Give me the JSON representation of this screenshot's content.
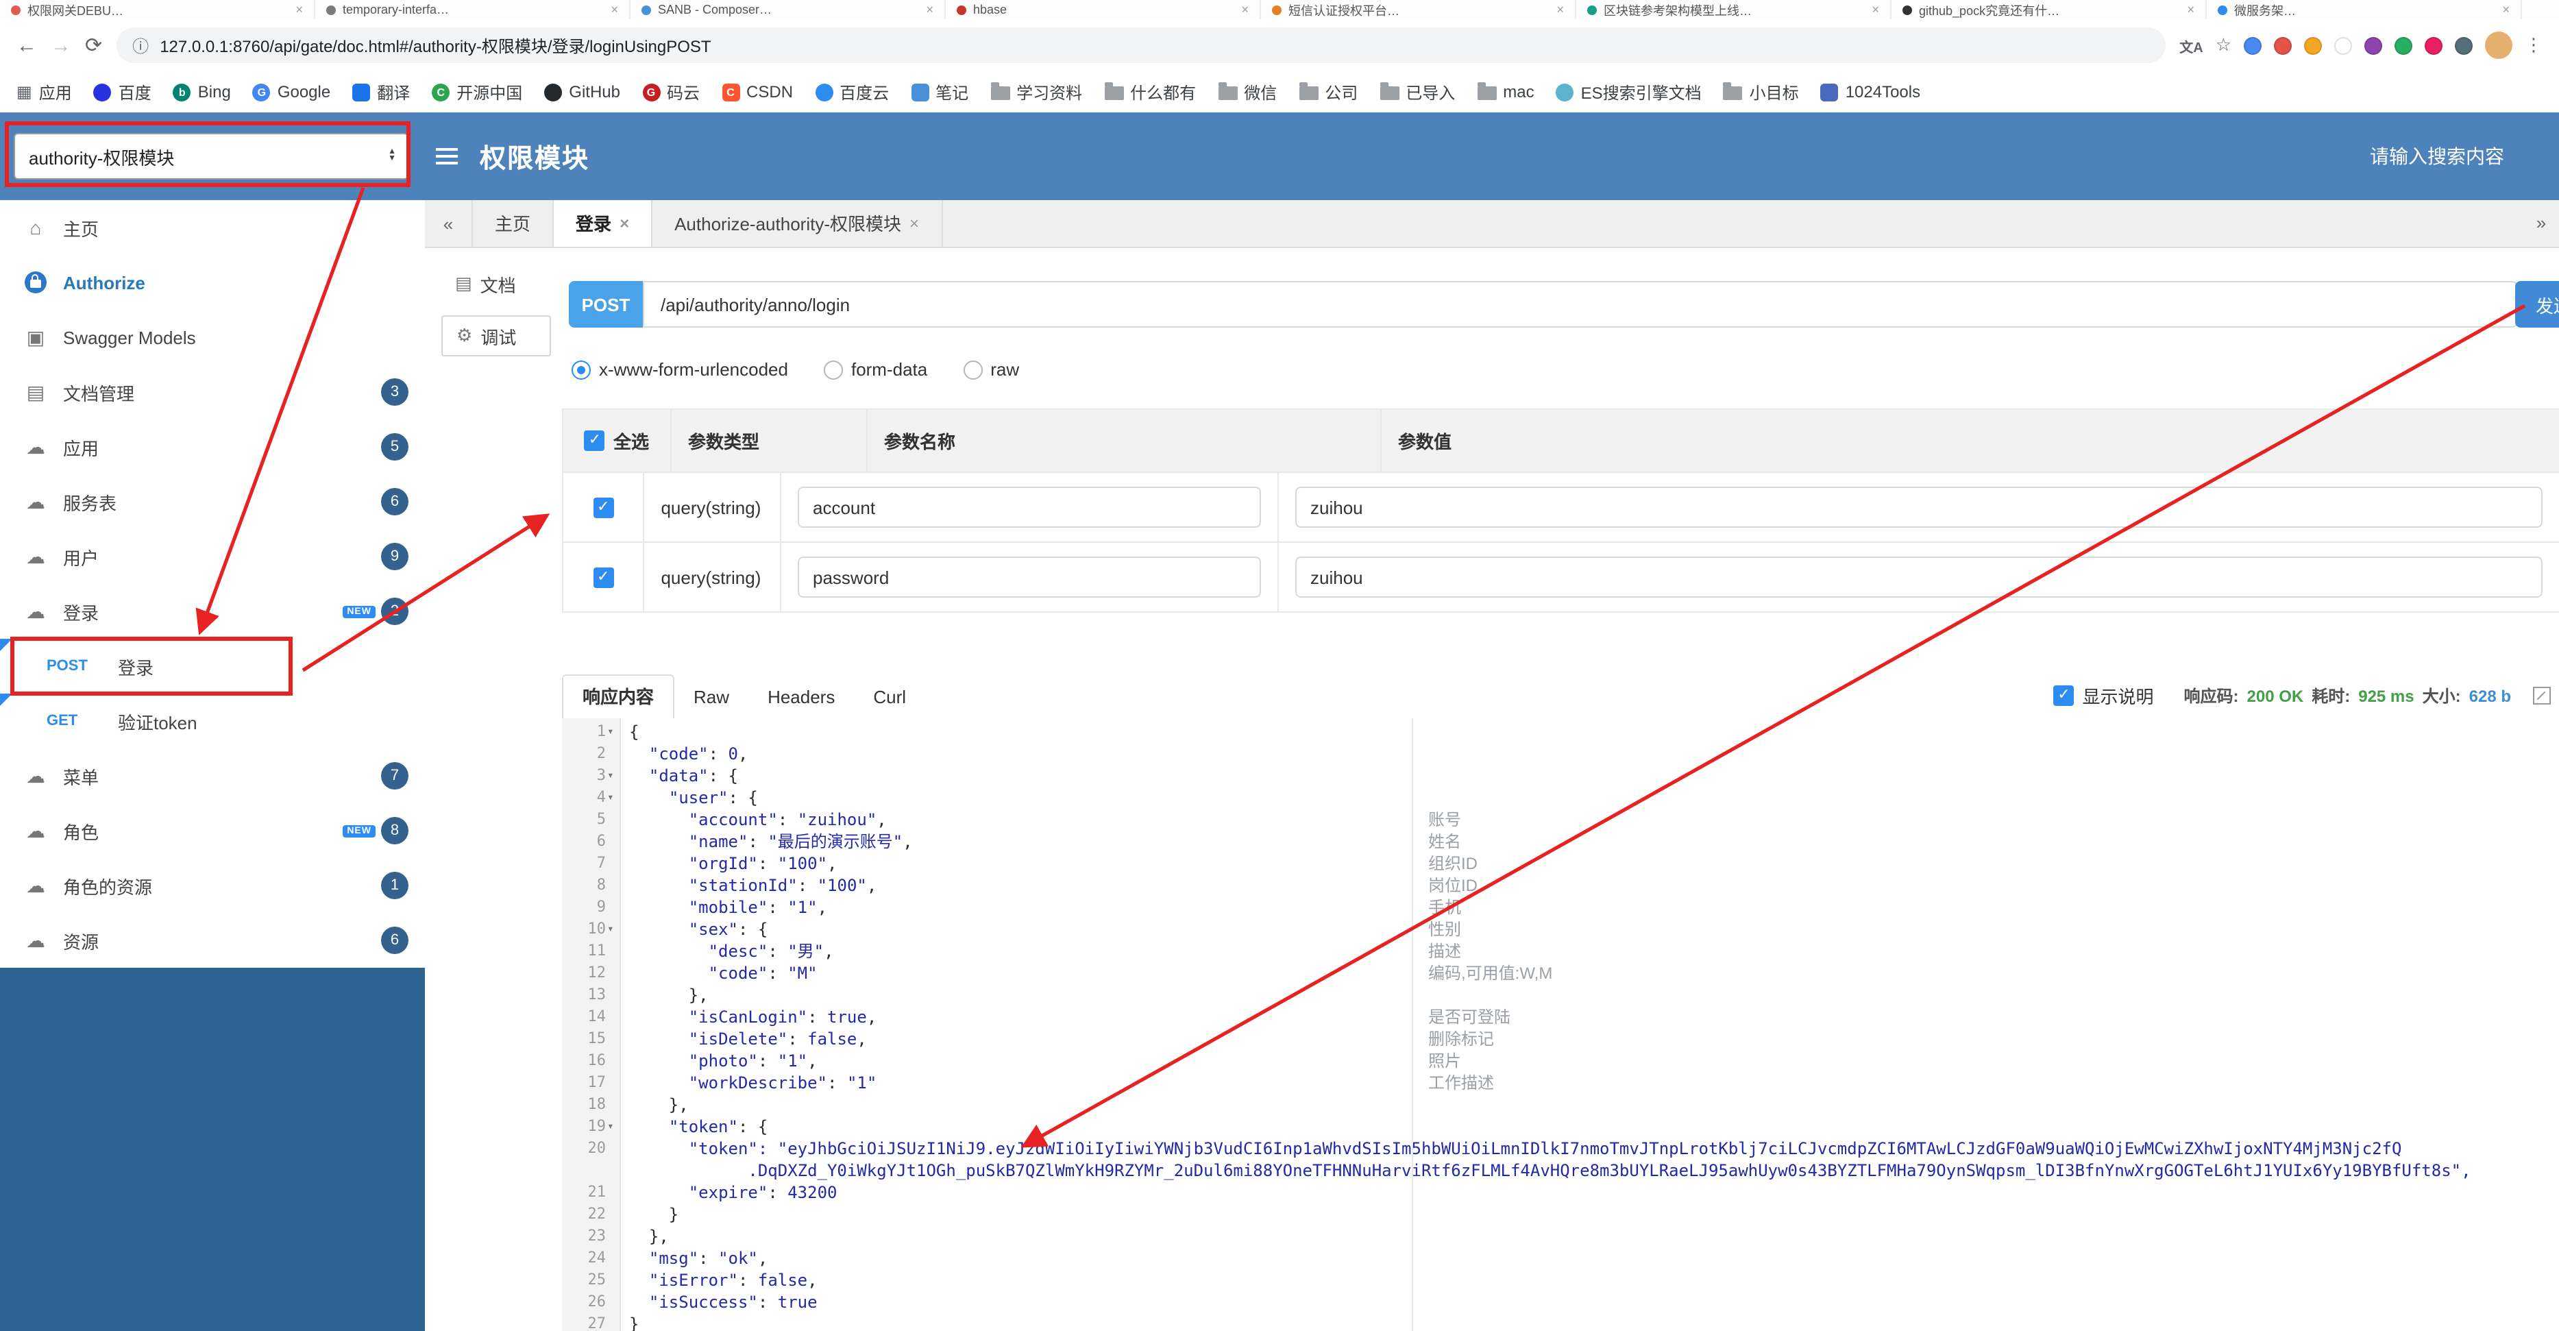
{
  "browser": {
    "tabs": [
      {
        "title": "权限网关DEBU…",
        "color": "#e05a4e"
      },
      {
        "title": "temporary-interfa…",
        "color": "#7a7a7a"
      },
      {
        "title": "SANB - Composer…",
        "color": "#4a90d9"
      },
      {
        "title": "hbase",
        "color": "#c0392b"
      },
      {
        "title": "短信认证授权平台…",
        "color": "#e67e22"
      },
      {
        "title": "区块链参考架构模型上线…",
        "color": "#16a085"
      },
      {
        "title": "github_pock究竟还有什…",
        "color": "#333333"
      },
      {
        "title": "微服务架…",
        "color": "#2d8cf0"
      }
    ],
    "url": "127.0.0.1:8760/api/gate/doc.html#/authority-权限模块/登录/loginUsingPOST",
    "ext_icons": [
      "#4a89f3",
      "#e2544a",
      "#f5a623",
      "#ffffff",
      "#8e44ad",
      "#27ae60",
      "#e91e63",
      "#546e7a"
    ],
    "bookmarks": [
      {
        "label": "应用",
        "icon": {
          "kind": "grid"
        }
      },
      {
        "label": "百度",
        "icon": {
          "kind": "circle",
          "color": "#2932e1"
        }
      },
      {
        "label": "Bing",
        "icon": {
          "kind": "circle",
          "color": "#008373",
          "letter": "b"
        }
      },
      {
        "label": "Google",
        "icon": {
          "kind": "circle",
          "color": "#4285f4",
          "letter": "G"
        }
      },
      {
        "label": "翻译",
        "icon": {
          "kind": "square",
          "color": "#1a73e8"
        }
      },
      {
        "label": "开源中国",
        "icon": {
          "kind": "circle",
          "color": "#2ea44f",
          "letter": "C"
        }
      },
      {
        "label": "GitHub",
        "icon": {
          "kind": "circle",
          "color": "#24292e"
        }
      },
      {
        "label": "码云",
        "icon": {
          "kind": "circle",
          "color": "#c71d23",
          "letter": "G"
        }
      },
      {
        "label": "CSDN",
        "icon": {
          "kind": "square",
          "color": "#fc5531",
          "letter": "C"
        }
      },
      {
        "label": "百度云",
        "icon": {
          "kind": "circle",
          "color": "#2d8cf0"
        }
      },
      {
        "label": "笔记",
        "icon": {
          "kind": "square",
          "color": "#4a90d9"
        }
      },
      {
        "label": "学习资料",
        "icon": {
          "kind": "folder"
        }
      },
      {
        "label": "什么都有",
        "icon": {
          "kind": "folder"
        }
      },
      {
        "label": "微信",
        "icon": {
          "kind": "folder"
        }
      },
      {
        "label": "公司",
        "icon": {
          "kind": "folder"
        }
      },
      {
        "label": "已导入",
        "icon": {
          "kind": "folder"
        }
      },
      {
        "label": "mac",
        "icon": {
          "kind": "folder"
        }
      },
      {
        "label": "ES搜索引擎文档",
        "icon": {
          "kind": "circle",
          "color": "#5cb3cc"
        }
      },
      {
        "label": "小目标",
        "icon": {
          "kind": "folder"
        }
      },
      {
        "label": "1024Tools",
        "icon": {
          "kind": "square",
          "color": "#4a69bd"
        }
      }
    ]
  },
  "header": {
    "module_select": "authority-权限模块",
    "title": "权限模块",
    "search_placeholder": "请输入搜索内容"
  },
  "sidebar": {
    "items": [
      {
        "key": "home",
        "label": "主页",
        "icon": "home"
      },
      {
        "key": "authorize",
        "label": "Authorize",
        "icon": "lock",
        "active": true
      },
      {
        "key": "swagger-models",
        "label": "Swagger Models",
        "icon": "models"
      },
      {
        "key": "doc-manage",
        "label": "文档管理",
        "icon": "doc",
        "badge": "3"
      },
      {
        "key": "app",
        "label": "应用",
        "icon": "cloud",
        "badge": "5"
      },
      {
        "key": "service",
        "label": "服务表",
        "icon": "cloud",
        "badge": "6"
      },
      {
        "key": "user",
        "label": "用户",
        "icon": "cloud",
        "badge": "9"
      },
      {
        "key": "login",
        "label": "登录",
        "icon": "cloud",
        "badge": "2",
        "new": true
      },
      {
        "key": "login-post",
        "label": "登录",
        "method": "POST"
      },
      {
        "key": "verify-token-get",
        "label": "验证token",
        "method": "GET"
      },
      {
        "key": "menu",
        "label": "菜单",
        "icon": "cloud",
        "badge": "7"
      },
      {
        "key": "role",
        "label": "角色",
        "icon": "cloud",
        "badge": "8",
        "new": true
      },
      {
        "key": "role-resource",
        "label": "角色的资源",
        "icon": "cloud",
        "badge": "1"
      },
      {
        "key": "resource",
        "label": "资源",
        "icon": "cloud",
        "badge": "6"
      }
    ]
  },
  "tabbar": {
    "left_collapse": "«",
    "right_collapse": "»",
    "tabs": [
      {
        "label": "主页"
      },
      {
        "label": "登录",
        "close": true,
        "active": true
      },
      {
        "label": "Authorize-authority-权限模块",
        "close": true
      }
    ]
  },
  "doc_tabs": [
    {
      "label": "文档",
      "icon": "doc"
    },
    {
      "label": "调试",
      "icon": "debug",
      "active": true
    }
  ],
  "request": {
    "method": "POST",
    "path": "/api/authority/anno/login",
    "send_label": "发送",
    "body_types": [
      {
        "label": "x-www-form-urlencoded",
        "selected": true
      },
      {
        "label": "form-data"
      },
      {
        "label": "raw"
      }
    ]
  },
  "params_table": {
    "headers": {
      "select_all": "全选",
      "type": "参数类型",
      "name": "参数名称",
      "value": "参数值"
    },
    "rows": [
      {
        "checked": true,
        "type": "query(string)",
        "name": "account",
        "value": "zuihou"
      },
      {
        "checked": true,
        "type": "query(string)",
        "name": "password",
        "value": "zuihou"
      }
    ]
  },
  "response": {
    "tabs": [
      "响应内容",
      "Raw",
      "Headers",
      "Curl"
    ],
    "active_tab": "响应内容",
    "show_desc_label": "显示说明",
    "status_label": "响应码:",
    "status_value": "200 OK",
    "time_label": "耗时:",
    "time_value": "925 ms",
    "size_label": "大小:",
    "size_value": "628 b"
  },
  "editor": {
    "lines": [
      {
        "n": "1",
        "fold": true,
        "text": "{"
      },
      {
        "n": "2",
        "text": "  \"code\": 0,"
      },
      {
        "n": "3",
        "fold": true,
        "text": "  \"data\": {"
      },
      {
        "n": "4",
        "fold": true,
        "text": "    \"user\": {"
      },
      {
        "n": "5",
        "text": "      \"account\": \"zuihou\","
      },
      {
        "n": "6",
        "text": "      \"name\": \"最后的演示账号\","
      },
      {
        "n": "7",
        "text": "      \"orgId\": \"100\","
      },
      {
        "n": "8",
        "text": "      \"stationId\": \"100\","
      },
      {
        "n": "9",
        "text": "      \"mobile\": \"1\","
      },
      {
        "n": "10",
        "fold": true,
        "text": "      \"sex\": {"
      },
      {
        "n": "11",
        "text": "        \"desc\": \"男\","
      },
      {
        "n": "12",
        "text": "        \"code\": \"M\""
      },
      {
        "n": "13",
        "text": "      },"
      },
      {
        "n": "14",
        "text": "      \"isCanLogin\": true,"
      },
      {
        "n": "15",
        "text": "      \"isDelete\": false,"
      },
      {
        "n": "16",
        "text": "      \"photo\": \"1\","
      },
      {
        "n": "17",
        "text": "      \"workDescribe\": \"1\""
      },
      {
        "n": "18",
        "text": "    },"
      },
      {
        "n": "19",
        "fold": true,
        "text": "    \"token\": {"
      },
      {
        "n": "20",
        "str": true,
        "text": "      \"token\": \"eyJhbGciOiJSUzI1NiJ9.eyJzdWIiOiIyIiwiYWNjb3VudCI6Inp1aWhvdSIsIm5hbWUiOiLmnIDlkI7nmoTmvJTnpLrotKblj7ciLCJvcmdpZCI6MTAwLCJzdGF0aW9uaWQiOjEwMCwiZXhwIjoxNTY4MjM3Njc2fQ"
      },
      {
        "n": "",
        "str": true,
        "text": "            .DqDXZd_Y0iWkgYJt1OGh_puSkB7QZlWmYkH9RZYMr_2uDul6mi88YOneTFHNNuHarviRtf6zFLMLf4AvHQre8m3bUYLRaeLJ95awhUyw0s43BYZTLFMHa79OynSWqpsm_lDI3BfnYnwXrgGOGTeL6htJ1YUIx6Yy19BYBfUft8s\","
      },
      {
        "n": "21",
        "text": "      \"expire\": 43200"
      },
      {
        "n": "22",
        "text": "    }"
      },
      {
        "n": "23",
        "text": "  },"
      },
      {
        "n": "24",
        "text": "  \"msg\": \"ok\","
      },
      {
        "n": "25",
        "text": "  \"isError\": false,"
      },
      {
        "n": "26",
        "text": "  \"isSuccess\": true"
      },
      {
        "n": "27",
        "text": "}"
      }
    ],
    "annotations": [
      {
        "line": 5,
        "text": "账号"
      },
      {
        "line": 6,
        "text": "姓名"
      },
      {
        "line": 7,
        "text": "组织ID"
      },
      {
        "line": 8,
        "text": "岗位ID"
      },
      {
        "line": 9,
        "text": "手机"
      },
      {
        "line": 10,
        "text": "性别"
      },
      {
        "line": 11,
        "text": "描述"
      },
      {
        "line": 12,
        "text": "编码,可用值:W,M"
      },
      {
        "line": 14,
        "text": "是否可登陆"
      },
      {
        "line": 15,
        "text": "删除标记"
      },
      {
        "line": 16,
        "text": "照片"
      },
      {
        "line": 17,
        "text": "工作描述"
      }
    ]
  },
  "colors": {
    "header_bg": "#4d82ba",
    "sidebar_bg": "#2f6391",
    "accent_blue": "#2d8cf0",
    "method_badge": "#4aa3e8",
    "annotation_red": "#e62222",
    "status_green": "#43a047"
  }
}
